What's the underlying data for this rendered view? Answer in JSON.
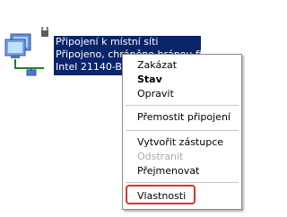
{
  "connection": {
    "lines": [
      "Připojení k místní síti",
      "Připojeno, chráněno bránou fi",
      "Intel 21140-Ba"
    ],
    "icon": "network-connection-icon"
  },
  "context_menu": {
    "items": [
      {
        "label": "Zakázat",
        "style": "normal"
      },
      {
        "label": "Stav",
        "style": "bold"
      },
      {
        "label": "Opravit",
        "style": "normal"
      },
      {
        "label": "Přemostit připojení",
        "style": "normal"
      },
      {
        "label": "Vytvořit zástupce",
        "style": "normal"
      },
      {
        "label": "Odstranit",
        "style": "disabled"
      },
      {
        "label": "Přejmenovat",
        "style": "normal"
      },
      {
        "label": "Vlastnosti",
        "style": "normal",
        "highlighted": true
      }
    ]
  },
  "colors": {
    "selection": "#0a246a",
    "highlight_border": "#e0332c"
  }
}
